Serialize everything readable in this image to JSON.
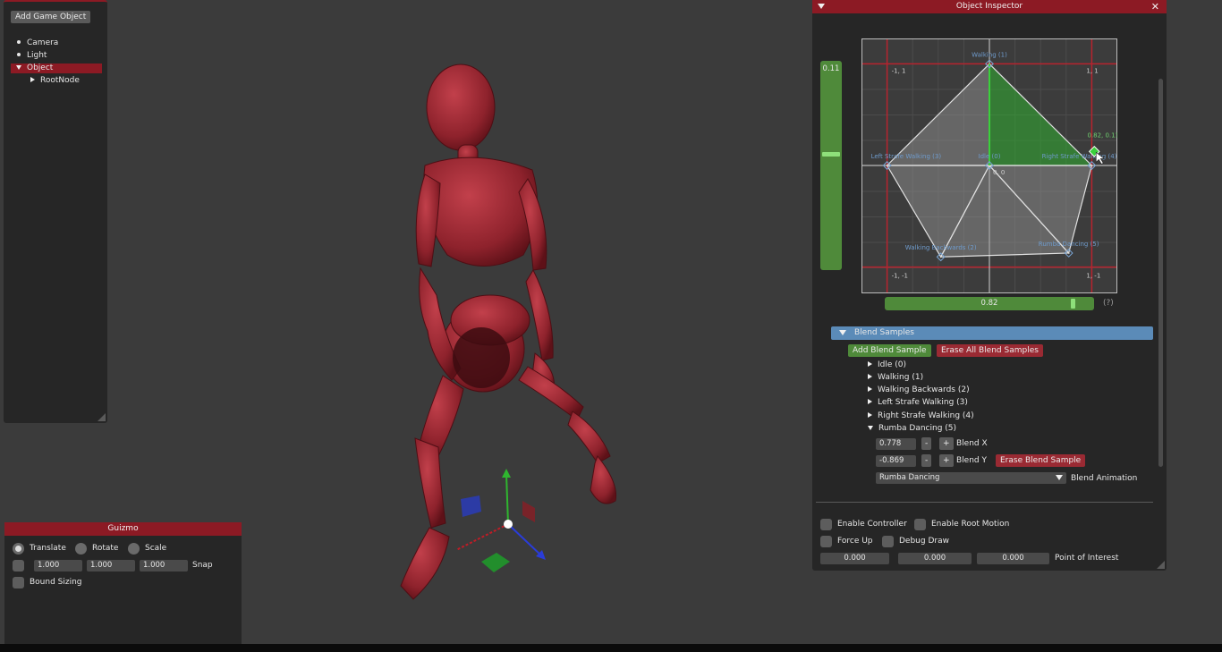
{
  "hierarchy": {
    "add_button": "Add Game Object",
    "items": [
      {
        "label": "Camera"
      },
      {
        "label": "Light"
      },
      {
        "label": "Object"
      },
      {
        "label": "RootNode"
      }
    ]
  },
  "guizmo": {
    "title": "Guizmo",
    "translate": "Translate",
    "rotate": "Rotate",
    "scale": "Scale",
    "snap_values": [
      "1.000",
      "1.000",
      "1.000"
    ],
    "snap": "Snap",
    "bound_sizing": "Bound Sizing"
  },
  "inspector": {
    "title": "Object Inspector",
    "blend_space": {
      "y_value": "0.11",
      "x_value": "0.82",
      "help": "(?)",
      "corner_labels": [
        "-1, 1",
        "1, 1",
        "-1, -1",
        "1, -1"
      ],
      "center_label": "0, 0",
      "cursor_label": "0.82, 0.11",
      "samples": [
        {
          "label": "Idle (0)",
          "x": 0,
          "y": 0
        },
        {
          "label": "Walking (1)",
          "x": 0,
          "y": 0.8
        },
        {
          "label": "Walking Backwards (2)",
          "x": -0.38,
          "y": -0.72
        },
        {
          "label": "Left Strafe Walking (3)",
          "x": -0.8,
          "y": 0
        },
        {
          "label": "Right Strafe Walking (4)",
          "x": 0.8,
          "y": 0
        },
        {
          "label": "Rumba Dancing (5)",
          "x": 0.62,
          "y": -0.69
        }
      ]
    },
    "blend_samples": {
      "header": "Blend Samples",
      "add_button": "Add Blend Sample",
      "erase_all_button": "Erase All Blend Samples",
      "items": [
        "Idle (0)",
        "Walking (1)",
        "Walking Backwards (2)",
        "Left Strafe Walking (3)",
        "Right Strafe Walking (4)",
        "Rumba Dancing (5)"
      ],
      "selected": {
        "blend_x_value": "0.778",
        "blend_x_label": "Blend X",
        "blend_y_value": "-0.869",
        "blend_y_label": "Blend Y",
        "minus": "-",
        "plus": "+",
        "erase_button": "Erase Blend Sample",
        "animation": "Rumba Dancing",
        "animation_label": "Blend Animation"
      }
    },
    "options": {
      "enable_controller": "Enable Controller",
      "enable_root_motion": "Enable Root Motion",
      "force_up": "Force Up",
      "debug_draw": "Debug Draw",
      "poi_values": [
        "0.000",
        "0.000",
        "0.000"
      ],
      "poi_label": "Point of Interest"
    }
  },
  "colors": {
    "accent_red": "#8c1a24",
    "blend_header_blue": "#5b8bb8",
    "slider_green": "#4f8a3a",
    "figure_red": "#9e2c36"
  }
}
